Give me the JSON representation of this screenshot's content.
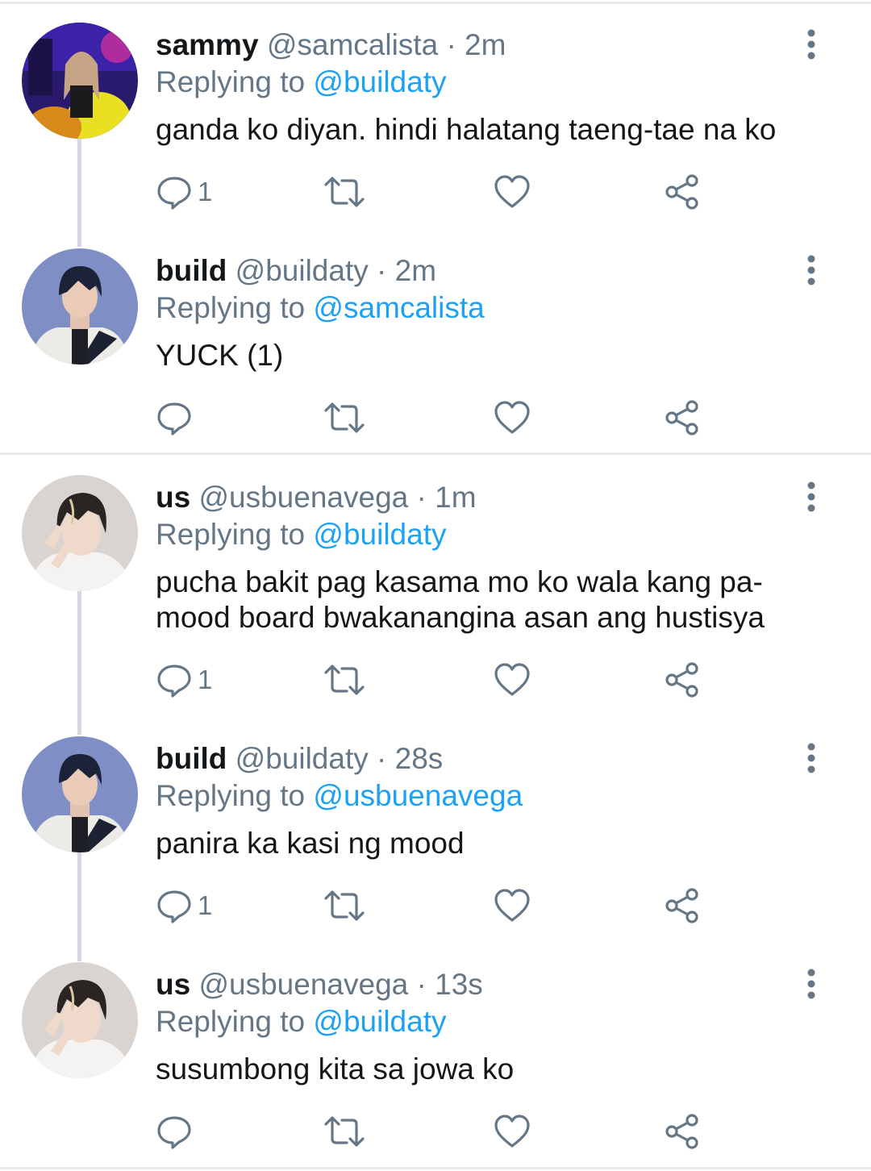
{
  "colors": {
    "accent": "#1da1f2",
    "text_primary": "#14171a",
    "text_secondary": "#657786",
    "icon": "#657786",
    "divider": "#e6ecf0",
    "thread_line": "#d3d9de"
  },
  "tweets": [
    {
      "display_name": "sammy",
      "handle": "@samcalista",
      "time": "2m",
      "replying_label": "Replying to",
      "reply_to": "@buildaty",
      "text": "ganda ko diyan. hindi halatang taeng-tae na ko",
      "reply_count": "1",
      "avatar": "avatar-sammy"
    },
    {
      "display_name": "build",
      "handle": "@buildaty",
      "time": "2m",
      "replying_label": "Replying to",
      "reply_to": "@samcalista",
      "text": "YUCK (1)",
      "reply_count": "",
      "avatar": "avatar-build"
    },
    {
      "display_name": "us",
      "handle": "@usbuenavega",
      "time": "1m",
      "replying_label": "Replying to",
      "reply_to": "@buildaty",
      "text": "pucha bakit pag kasama mo ko wala kang pa-mood board bwakanangina asan ang hustisya",
      "reply_count": "1",
      "avatar": "avatar-us"
    },
    {
      "display_name": "build",
      "handle": "@buildaty",
      "time": "28s",
      "replying_label": "Replying to",
      "reply_to": "@usbuenavega",
      "text": "panira ka kasi ng mood",
      "reply_count": "1",
      "avatar": "avatar-build"
    },
    {
      "display_name": "us",
      "handle": "@usbuenavega",
      "time": "13s",
      "replying_label": "Replying to",
      "reply_to": "@buildaty",
      "text": "susumbong kita sa jowa ko",
      "reply_count": "",
      "avatar": "avatar-us"
    }
  ],
  "icons": {
    "reply": "reply-icon",
    "retweet": "retweet-icon",
    "like": "heart-icon",
    "share": "share-icon",
    "more": "more-vertical-icon"
  }
}
